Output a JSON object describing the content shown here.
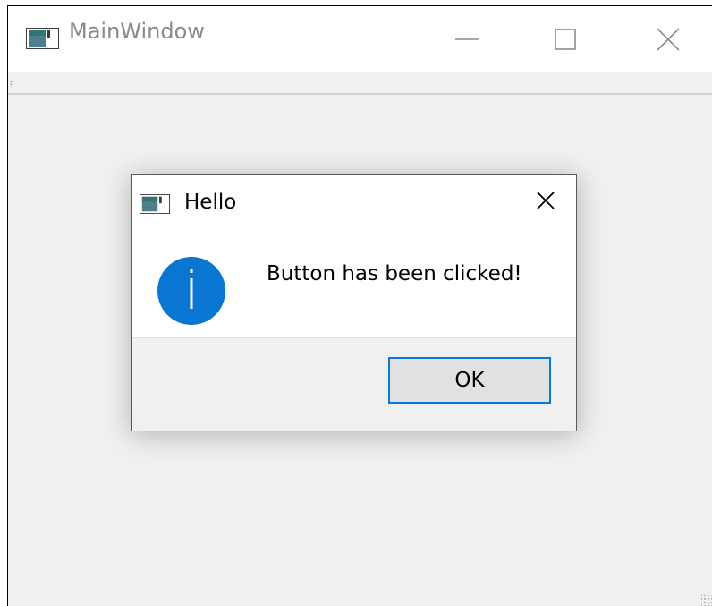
{
  "main_window": {
    "title": "MainWindow",
    "icon": "app-window-icon",
    "controls": {
      "minimize": "minimize-icon",
      "maximize": "maximize-icon",
      "close": "close-icon"
    }
  },
  "dialog": {
    "title": "Hello",
    "icon": "app-window-icon",
    "message": "Button has been clicked!",
    "message_icon": "info-icon",
    "ok_label": "OK",
    "accent": "#0a78d7",
    "info_color": "#0a76d2"
  }
}
